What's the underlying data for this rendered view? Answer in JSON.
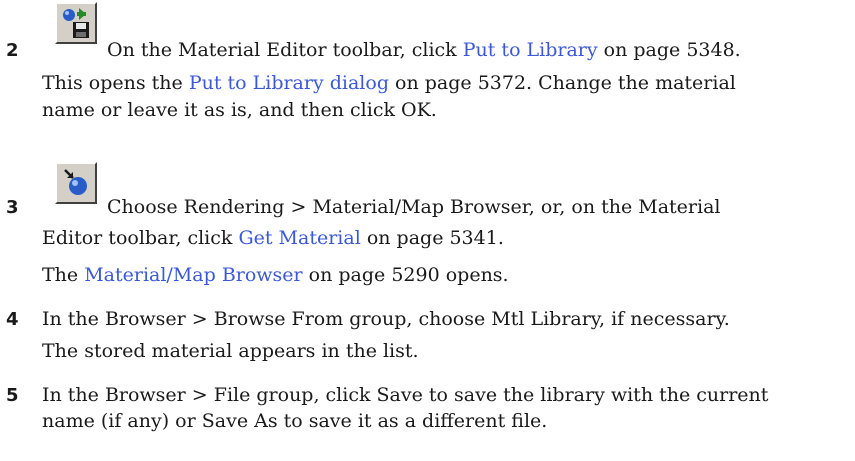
{
  "step2": {
    "number": "2",
    "icon": "put-to-library-icon",
    "line1_pre": "On the Material Editor toolbar, click ",
    "line1_link": "Put to Library",
    "line1_post": " on page 5348.",
    "line2_pre": "This opens the ",
    "line2_link": "Put to Library dialog",
    "line2_post": " on page 5372. Change the material",
    "line3": "name or leave it as is, and then click OK."
  },
  "step3": {
    "number": "3",
    "icon": "get-material-icon",
    "line1": "Choose Rendering > Material/Map Browser, or, on the Material",
    "line2_pre": "Editor toolbar, click ",
    "line2_link": "Get Material",
    "line2_post": " on page 5341.",
    "line3_pre": "The ",
    "line3_link": "Material/Map Browser",
    "line3_post": " on page 5290 opens."
  },
  "step4": {
    "number": "4",
    "line1": "In the Browser > Browse From group, choose Mtl Library, if necessary.",
    "line2": "The stored material appears in the list."
  },
  "step5": {
    "number": "5",
    "line1": "In the Browser > File group, click Save to save the library with the current",
    "line2": "name (if any) or Save As to save it as a different file."
  }
}
